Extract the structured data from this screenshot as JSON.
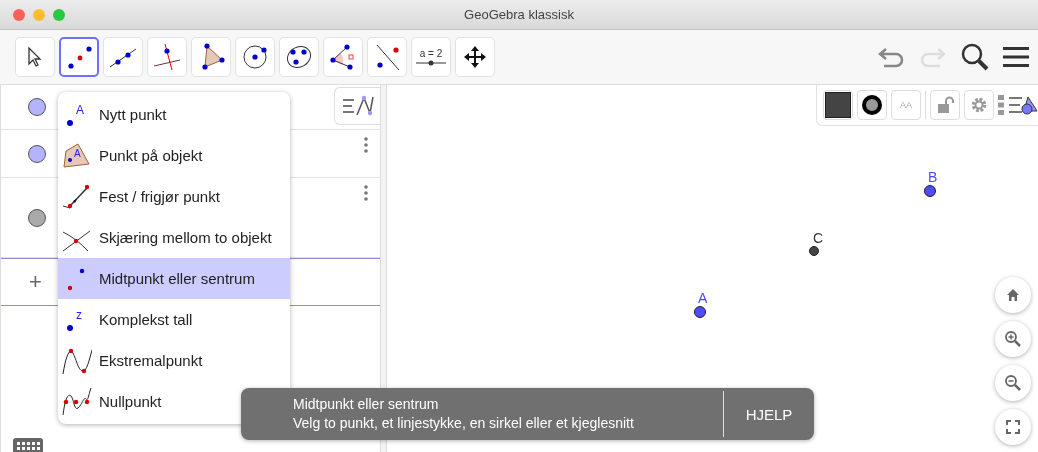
{
  "window": {
    "title": "GeoGebra klassisk"
  },
  "toolbar": {
    "tools": [
      {
        "kind": "move",
        "selected": false
      },
      {
        "kind": "midpoint",
        "selected": true
      },
      {
        "kind": "line",
        "selected": false
      },
      {
        "kind": "perpendicular",
        "selected": false
      },
      {
        "kind": "polygon",
        "selected": false
      },
      {
        "kind": "circle",
        "selected": false
      },
      {
        "kind": "conic",
        "selected": false
      },
      {
        "kind": "angle",
        "selected": false
      },
      {
        "kind": "reflect",
        "selected": false
      },
      {
        "kind": "slider",
        "selected": false,
        "label": "a = 2"
      },
      {
        "kind": "pan",
        "selected": false
      }
    ]
  },
  "algebra": {
    "rows": [
      {
        "color": "#b3b3ff",
        "menu": false
      },
      {
        "color": "#b3b3ff",
        "menu": true
      },
      {
        "color": "#aaaaaa",
        "menu": true
      }
    ],
    "input_symbol": "+"
  },
  "tool_menu": {
    "items": [
      {
        "kind": "new-point",
        "label": "Nytt punkt",
        "selected": false,
        "icon_letter": "A"
      },
      {
        "kind": "point-on-object",
        "label": "Punkt på objekt",
        "selected": false,
        "icon_letter": "A"
      },
      {
        "kind": "attach",
        "label": "Fest / frigjør punkt",
        "selected": false
      },
      {
        "kind": "intersect",
        "label": "Skjæring mellom to objekt",
        "selected": false
      },
      {
        "kind": "midpoint",
        "label": "Midtpunkt eller sentrum",
        "selected": true
      },
      {
        "kind": "complex",
        "label": "Komplekst tall",
        "selected": false,
        "icon_letter": "z"
      },
      {
        "kind": "extremum",
        "label": "Ekstremalpunkt",
        "selected": false
      },
      {
        "kind": "roots",
        "label": "Nullpunkt",
        "selected": false
      }
    ]
  },
  "style_bar": {
    "text_size": "AA"
  },
  "graphics": {
    "points": [
      {
        "label": "A",
        "color": "#4d4dff"
      },
      {
        "label": "B",
        "color": "#4d4dff"
      },
      {
        "label": "C",
        "color": "#444444"
      }
    ]
  },
  "tooltip": {
    "title": "Midtpunkt eller sentrum",
    "text": "Velg to punkt, et linjestykke, en sirkel eller et kjeglesnitt",
    "button": "HJELP"
  }
}
